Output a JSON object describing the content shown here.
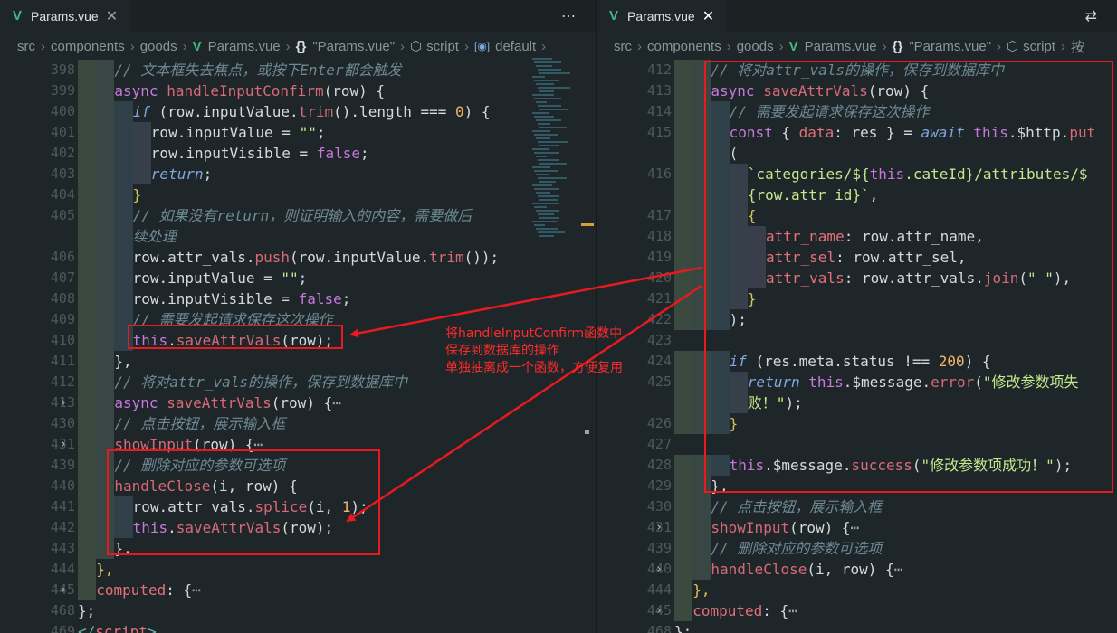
{
  "left_pane": {
    "tab_label": "Params.vue",
    "tab_close_glyph": "✕",
    "tab_actions_glyph": "⋯",
    "breadcrumb": {
      "src": "src",
      "components": "components",
      "goods": "goods",
      "file": "Params.vue",
      "object": "\"Params.vue\"",
      "script": "script",
      "var": "default"
    }
  },
  "right_pane": {
    "tab_label": "Params.vue",
    "tab_close_glyph": "✕",
    "tab_actions_glyph": "⇄",
    "breadcrumb": {
      "src": "src",
      "components": "components",
      "goods": "goods",
      "file": "Params.vue",
      "object": "\"Params.vue\"",
      "script": "script",
      "var": "按"
    }
  },
  "left_lines": [
    {
      "ln": "398",
      "indent": 2,
      "tokens": [
        [
          "// 文本框失去焦点，或按下Enter都会触发",
          "comment"
        ]
      ]
    },
    {
      "ln": "399",
      "indent": 2,
      "tokens": [
        [
          "async ",
          "keyword"
        ],
        [
          "handleInputConfirm",
          "function"
        ],
        [
          "(row) {",
          "plain"
        ]
      ]
    },
    {
      "ln": "400",
      "indent": 3,
      "tokens": [
        [
          "if",
          "control"
        ],
        [
          " (row.inputValue.",
          "plain"
        ],
        [
          "trim",
          "function"
        ],
        [
          "().length === ",
          "plain"
        ],
        [
          "0",
          "number"
        ],
        [
          ") {",
          "plain"
        ]
      ]
    },
    {
      "ln": "401",
      "indent": 4,
      "tokens": [
        [
          "row.inputValue = ",
          "plain"
        ],
        [
          "\"\"",
          "string"
        ],
        [
          ";",
          "plain"
        ]
      ]
    },
    {
      "ln": "402",
      "indent": 4,
      "tokens": [
        [
          "row.inputVisible = ",
          "plain"
        ],
        [
          "false",
          "keyword"
        ],
        [
          ";",
          "plain"
        ]
      ]
    },
    {
      "ln": "403",
      "indent": 4,
      "tokens": [
        [
          "return",
          "control"
        ],
        [
          ";",
          "plain"
        ]
      ]
    },
    {
      "ln": "404",
      "indent": 3,
      "tokens": [
        [
          "}",
          "bracket"
        ]
      ]
    },
    {
      "ln": "405",
      "indent": 3,
      "tokens": [
        [
          "// 如果没有return，则证明输入的内容，需要做后",
          "comment"
        ]
      ]
    },
    {
      "ln": "",
      "indent": 3,
      "tokens": [
        [
          "续处理",
          "comment"
        ]
      ]
    },
    {
      "ln": "406",
      "indent": 3,
      "tokens": [
        [
          "row.attr_vals.",
          "plain"
        ],
        [
          "push",
          "function"
        ],
        [
          "(row.inputValue.",
          "plain"
        ],
        [
          "trim",
          "function"
        ],
        [
          "());",
          "plain"
        ]
      ]
    },
    {
      "ln": "407",
      "indent": 3,
      "tokens": [
        [
          "row.inputValue = ",
          "plain"
        ],
        [
          "\"\"",
          "string"
        ],
        [
          ";",
          "plain"
        ]
      ]
    },
    {
      "ln": "408",
      "indent": 3,
      "tokens": [
        [
          "row.inputVisible = ",
          "plain"
        ],
        [
          "false",
          "keyword"
        ],
        [
          ";",
          "plain"
        ]
      ]
    },
    {
      "ln": "409",
      "indent": 3,
      "tokens": [
        [
          "// 需要发起请求保存这次操作",
          "comment"
        ]
      ]
    },
    {
      "ln": "410",
      "indent": 3,
      "tokens": [
        [
          "this",
          "keyword"
        ],
        [
          ".",
          "plain"
        ],
        [
          "saveAttrVals",
          "function"
        ],
        [
          "(row);",
          "plain"
        ]
      ]
    },
    {
      "ln": "411",
      "indent": 2,
      "tokens": [
        [
          "},",
          "plain"
        ]
      ]
    },
    {
      "ln": "412",
      "indent": 2,
      "tokens": [
        [
          "// 将对attr_vals的操作，保存到数据库中",
          "comment"
        ]
      ]
    },
    {
      "ln": "413",
      "indent": 2,
      "fold": "›",
      "tokens": [
        [
          "async ",
          "keyword"
        ],
        [
          "saveAttrVals",
          "function"
        ],
        [
          "(row) {",
          "plain"
        ],
        [
          "⋯",
          "fold"
        ]
      ]
    },
    {
      "ln": "430",
      "indent": 2,
      "tokens": [
        [
          "// 点击按钮，展示输入框",
          "comment"
        ]
      ]
    },
    {
      "ln": "431",
      "indent": 2,
      "fold": "›",
      "tokens": [
        [
          "showInput",
          "function"
        ],
        [
          "(row) {",
          "plain"
        ],
        [
          "⋯",
          "fold"
        ]
      ]
    },
    {
      "ln": "439",
      "indent": 2,
      "tokens": [
        [
          "// 删除对应的参数可选项",
          "comment"
        ]
      ]
    },
    {
      "ln": "440",
      "indent": 2,
      "tokens": [
        [
          "handleClose",
          "function"
        ],
        [
          "(i, row) {",
          "plain"
        ]
      ]
    },
    {
      "ln": "441",
      "indent": 3,
      "tokens": [
        [
          "row.attr_vals.",
          "plain"
        ],
        [
          "splice",
          "function"
        ],
        [
          "(i, ",
          "plain"
        ],
        [
          "1",
          "number"
        ],
        [
          ");",
          "plain"
        ]
      ]
    },
    {
      "ln": "442",
      "indent": 3,
      "tokens": [
        [
          "this",
          "keyword"
        ],
        [
          ".",
          "plain"
        ],
        [
          "saveAttrVals",
          "function"
        ],
        [
          "(row);",
          "plain"
        ]
      ]
    },
    {
      "ln": "443",
      "indent": 2,
      "tokens": [
        [
          "},",
          "plain"
        ]
      ]
    },
    {
      "ln": "444",
      "indent": 1,
      "tokens": [
        [
          "},",
          "bracket"
        ]
      ]
    },
    {
      "ln": "445",
      "indent": 1,
      "fold": "›",
      "tokens": [
        [
          "computed",
          "property"
        ],
        [
          ": {",
          "plain"
        ],
        [
          "⋯",
          "fold"
        ]
      ]
    },
    {
      "ln": "468",
      "indent": 0,
      "tokens": [
        [
          "};",
          "plain"
        ]
      ]
    },
    {
      "ln": "469",
      "indent": 0,
      "tokens": [
        [
          "</",
          "tag"
        ],
        [
          "script",
          "tagname"
        ],
        [
          ">",
          "tag"
        ]
      ]
    }
  ],
  "right_lines": [
    {
      "ln": "412",
      "indent": 2,
      "tokens": [
        [
          "// 将对attr_vals的操作，保存到数据库中",
          "comment"
        ]
      ]
    },
    {
      "ln": "413",
      "indent": 2,
      "tokens": [
        [
          "async ",
          "keyword"
        ],
        [
          "saveAttrVals",
          "function"
        ],
        [
          "(row) {",
          "plain"
        ]
      ]
    },
    {
      "ln": "414",
      "indent": 3,
      "tokens": [
        [
          "// 需要发起请求保存这次操作",
          "comment"
        ]
      ]
    },
    {
      "ln": "415",
      "indent": 3,
      "tokens": [
        [
          "const",
          "keyword"
        ],
        [
          " { ",
          "plain"
        ],
        [
          "data",
          "property"
        ],
        [
          ": res } = ",
          "plain"
        ],
        [
          "await",
          "control"
        ],
        [
          " ",
          "plain"
        ],
        [
          "this",
          "keyword"
        ],
        [
          ".$http.",
          "plain"
        ],
        [
          "put",
          "function"
        ]
      ]
    },
    {
      "ln": "",
      "indent": 3,
      "tokens": [
        [
          "(",
          "plain"
        ]
      ]
    },
    {
      "ln": "416",
      "indent": 4,
      "tokens": [
        [
          "`categories/${",
          "string"
        ],
        [
          "this",
          "keyword"
        ],
        [
          ".cateId}/attributes/$",
          "string"
        ]
      ]
    },
    {
      "ln": "",
      "indent": 4,
      "tokens": [
        [
          "{row.attr_id}`",
          "string"
        ],
        [
          ",",
          "plain"
        ]
      ]
    },
    {
      "ln": "417",
      "indent": 4,
      "tokens": [
        [
          "{",
          "bracket"
        ]
      ]
    },
    {
      "ln": "418",
      "indent": 5,
      "tokens": [
        [
          "attr_name",
          "property"
        ],
        [
          ": row.attr_name,",
          "plain"
        ]
      ]
    },
    {
      "ln": "419",
      "indent": 5,
      "tokens": [
        [
          "attr_sel",
          "property"
        ],
        [
          ": row.attr_sel,",
          "plain"
        ]
      ]
    },
    {
      "ln": "420",
      "indent": 5,
      "tokens": [
        [
          "attr_vals",
          "property"
        ],
        [
          ": row.attr_vals.",
          "plain"
        ],
        [
          "join",
          "function"
        ],
        [
          "(",
          "plain"
        ],
        [
          "\" \"",
          "string"
        ],
        [
          "),",
          "plain"
        ]
      ]
    },
    {
      "ln": "421",
      "indent": 4,
      "tokens": [
        [
          "}",
          "bracket"
        ]
      ]
    },
    {
      "ln": "422",
      "indent": 3,
      "tokens": [
        [
          ");",
          "plain"
        ]
      ]
    },
    {
      "ln": "423",
      "indent": 0,
      "tokens": []
    },
    {
      "ln": "424",
      "indent": 3,
      "tokens": [
        [
          "if",
          "control"
        ],
        [
          " (res.meta.status !== ",
          "plain"
        ],
        [
          "200",
          "number"
        ],
        [
          ") {",
          "plain"
        ]
      ]
    },
    {
      "ln": "425",
      "indent": 4,
      "tokens": [
        [
          "return",
          "control"
        ],
        [
          " ",
          "plain"
        ],
        [
          "this",
          "keyword"
        ],
        [
          ".$message.",
          "plain"
        ],
        [
          "error",
          "function"
        ],
        [
          "(",
          "plain"
        ],
        [
          "\"修改参数项失",
          "string"
        ]
      ]
    },
    {
      "ln": "",
      "indent": 4,
      "tokens": [
        [
          "败！\"",
          "string"
        ],
        [
          ");",
          "plain"
        ]
      ]
    },
    {
      "ln": "426",
      "indent": 3,
      "tokens": [
        [
          "}",
          "bracket"
        ]
      ]
    },
    {
      "ln": "427",
      "indent": 0,
      "tokens": []
    },
    {
      "ln": "428",
      "indent": 3,
      "tokens": [
        [
          "this",
          "keyword"
        ],
        [
          ".$message.",
          "plain"
        ],
        [
          "success",
          "function"
        ],
        [
          "(",
          "plain"
        ],
        [
          "\"修改参数项成功！\"",
          "string"
        ],
        [
          ");",
          "plain"
        ]
      ]
    },
    {
      "ln": "429",
      "indent": 2,
      "tokens": [
        [
          "},",
          "plain"
        ]
      ]
    },
    {
      "ln": "430",
      "indent": 2,
      "tokens": [
        [
          "// 点击按钮，展示输入框",
          "comment"
        ]
      ]
    },
    {
      "ln": "431",
      "indent": 2,
      "fold": "›",
      "tokens": [
        [
          "showInput",
          "function"
        ],
        [
          "(row) {",
          "plain"
        ],
        [
          "⋯",
          "fold"
        ]
      ]
    },
    {
      "ln": "439",
      "indent": 2,
      "tokens": [
        [
          "// 删除对应的参数可选项",
          "comment"
        ]
      ]
    },
    {
      "ln": "440",
      "indent": 2,
      "fold": "›",
      "tokens": [
        [
          "handleClose",
          "function"
        ],
        [
          "(i, row) {",
          "plain"
        ],
        [
          "⋯",
          "fold"
        ]
      ]
    },
    {
      "ln": "444",
      "indent": 1,
      "tokens": [
        [
          "},",
          "bracket"
        ]
      ]
    },
    {
      "ln": "445",
      "indent": 1,
      "fold": "›",
      "tokens": [
        [
          "computed",
          "property"
        ],
        [
          ": {",
          "plain"
        ],
        [
          "⋯",
          "fold"
        ]
      ]
    },
    {
      "ln": "468",
      "indent": 0,
      "tokens": [
        [
          "};",
          "plain"
        ]
      ]
    }
  ],
  "annotation": {
    "lines": [
      "将handleInputConfirm函数中",
      "保存到数据库的操作",
      "单独抽离成一个函数，方便复用"
    ],
    "color": "#e8191f"
  },
  "theme": {
    "comment": "#6d8a94",
    "keyword": "#c678dd",
    "control": "#7fa7e0",
    "function": "#d86a78",
    "string": "#c3e88d",
    "number": "#f0b46b",
    "property": "#e4707a",
    "plain": "#d4dadc",
    "bracket": "#d8c55a",
    "tag": "#6fb6b6",
    "tagname": "#e4707a",
    "fold": "#9aa4a8"
  }
}
